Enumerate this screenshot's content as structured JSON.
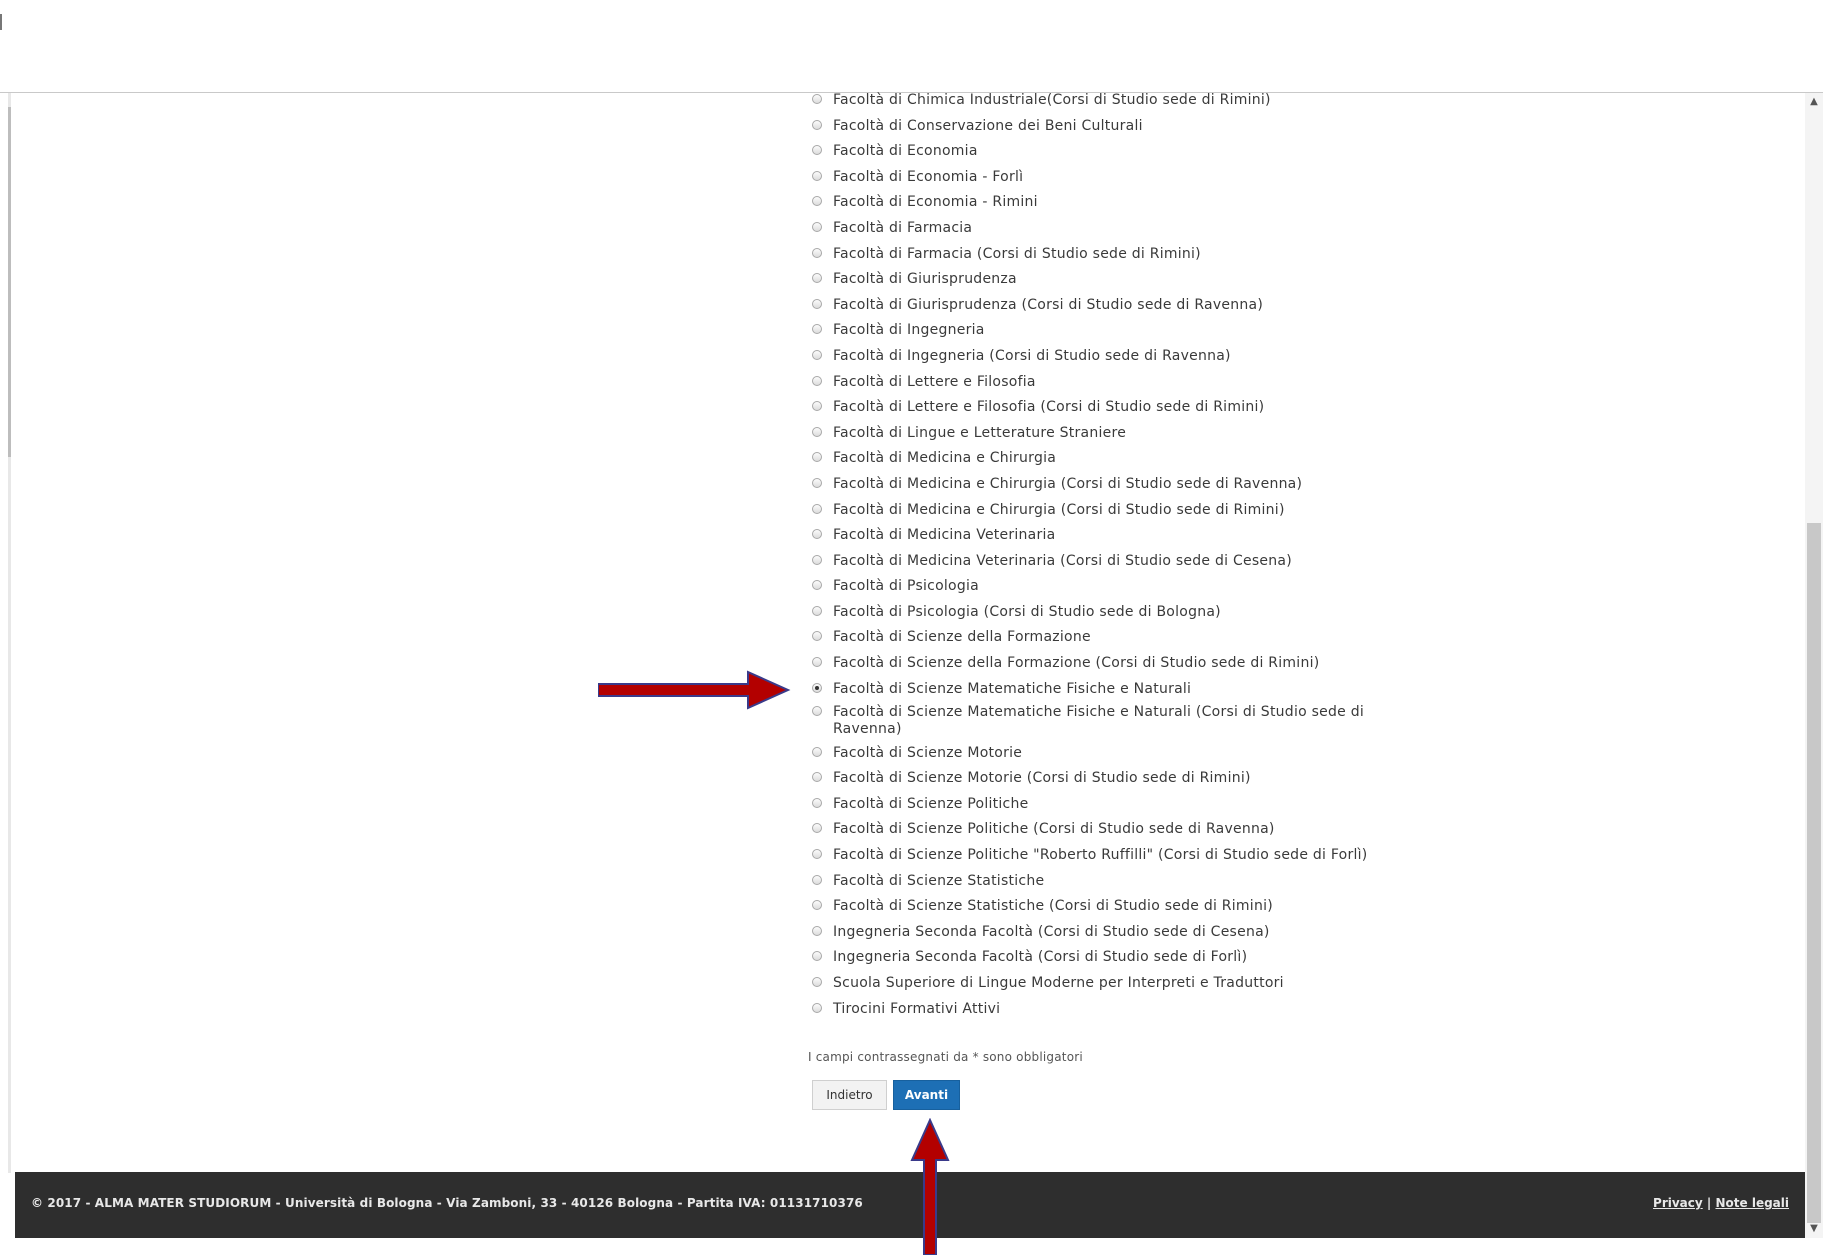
{
  "faculties": [
    {
      "label": "Facoltà di Chimica Industriale(Corsi di Studio sede di Rimini)",
      "selected": false
    },
    {
      "label": "Facoltà di Conservazione dei Beni Culturali",
      "selected": false
    },
    {
      "label": "Facoltà di Economia",
      "selected": false
    },
    {
      "label": "Facoltà di Economia - Forlì",
      "selected": false
    },
    {
      "label": "Facoltà di Economia - Rimini",
      "selected": false
    },
    {
      "label": "Facoltà di Farmacia",
      "selected": false
    },
    {
      "label": "Facoltà di Farmacia (Corsi di Studio sede di Rimini)",
      "selected": false
    },
    {
      "label": "Facoltà di Giurisprudenza",
      "selected": false
    },
    {
      "label": "Facoltà di Giurisprudenza (Corsi di Studio sede di Ravenna)",
      "selected": false
    },
    {
      "label": "Facoltà di Ingegneria",
      "selected": false
    },
    {
      "label": "Facoltà di Ingegneria (Corsi di Studio sede di Ravenna)",
      "selected": false
    },
    {
      "label": "Facoltà di Lettere e Filosofia",
      "selected": false
    },
    {
      "label": "Facoltà di Lettere e Filosofia (Corsi di Studio sede di Rimini)",
      "selected": false
    },
    {
      "label": "Facoltà di Lingue e Letterature Straniere",
      "selected": false
    },
    {
      "label": "Facoltà di Medicina e Chirurgia",
      "selected": false
    },
    {
      "label": "Facoltà di Medicina e Chirurgia (Corsi di Studio sede di Ravenna)",
      "selected": false
    },
    {
      "label": "Facoltà di Medicina e Chirurgia (Corsi di Studio sede di Rimini)",
      "selected": false
    },
    {
      "label": "Facoltà di Medicina Veterinaria",
      "selected": false
    },
    {
      "label": "Facoltà di Medicina Veterinaria (Corsi di Studio sede di Cesena)",
      "selected": false
    },
    {
      "label": "Facoltà di Psicologia",
      "selected": false
    },
    {
      "label": "Facoltà di Psicologia (Corsi di Studio sede di Bologna)",
      "selected": false
    },
    {
      "label": "Facoltà di Scienze della Formazione",
      "selected": false
    },
    {
      "label": "Facoltà di Scienze della Formazione (Corsi di Studio sede di Rimini)",
      "selected": false
    },
    {
      "label": "Facoltà di Scienze Matematiche Fisiche e Naturali",
      "selected": true
    },
    {
      "label": "Facoltà di Scienze Matematiche Fisiche e Naturali (Corsi di Studio sede di Ravenna)",
      "selected": false
    },
    {
      "label": "Facoltà di Scienze Motorie",
      "selected": false
    },
    {
      "label": "Facoltà di Scienze Motorie (Corsi di Studio sede di Rimini)",
      "selected": false
    },
    {
      "label": "Facoltà di Scienze Politiche",
      "selected": false
    },
    {
      "label": "Facoltà di Scienze Politiche (Corsi di Studio sede di Ravenna)",
      "selected": false
    },
    {
      "label": "Facoltà di Scienze Politiche \"Roberto Ruffilli\" (Corsi di Studio sede di Forlì)",
      "selected": false
    },
    {
      "label": "Facoltà di Scienze Statistiche",
      "selected": false
    },
    {
      "label": "Facoltà di Scienze Statistiche (Corsi di Studio sede di Rimini)",
      "selected": false
    },
    {
      "label": "Ingegneria Seconda Facoltà (Corsi di Studio sede di Cesena)",
      "selected": false
    },
    {
      "label": "Ingegneria Seconda Facoltà (Corsi di Studio sede di Forlì)",
      "selected": false
    },
    {
      "label": "Scuola Superiore di Lingue Moderne per Interpreti e Traduttori",
      "selected": false
    },
    {
      "label": "Tirocini Formativi Attivi",
      "selected": false
    }
  ],
  "form": {
    "required_note": "I campi contrassegnati da * sono obbligatori",
    "back_label": "Indietro",
    "next_label": "Avanti"
  },
  "footer": {
    "copyright": "© 2017 - ALMA MATER STUDIORUM - Università di Bologna - Via Zamboni, 33 - 40126 Bologna - Partita IVA: 01131710376",
    "privacy_label": "Privacy",
    "separator": "|",
    "legal_label": "Note legali"
  },
  "colors": {
    "primary_button": "#1d6fb5",
    "footer_bg": "#2e2e2e",
    "annotation_arrow": "#b30000"
  },
  "icons": {
    "scroll_up": "▲",
    "scroll_down": "▼"
  }
}
